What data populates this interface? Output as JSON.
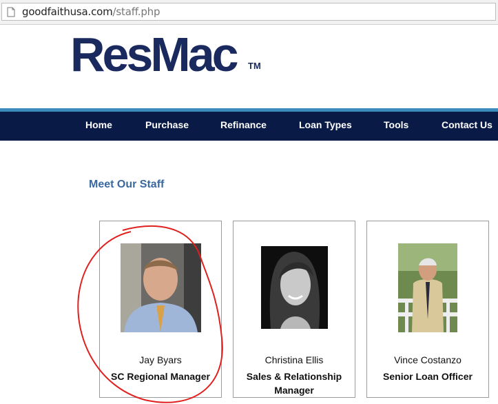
{
  "browser": {
    "url_host": "goodfaithusa.com",
    "url_path": "/staff.php"
  },
  "logo": {
    "text": "ResMac",
    "tm": "TM"
  },
  "nav": {
    "items": [
      {
        "label": "Home"
      },
      {
        "label": "Purchase"
      },
      {
        "label": "Refinance"
      },
      {
        "label": "Loan Types"
      },
      {
        "label": "Tools"
      },
      {
        "label": "Contact Us"
      }
    ]
  },
  "main": {
    "heading": "Meet Our Staff",
    "staff": [
      {
        "name": "Jay Byars",
        "role": "SC Regional Manager"
      },
      {
        "name": "Christina Ellis",
        "role": "Sales & Relationship Manager"
      },
      {
        "name": "Vince Costanzo",
        "role": "Senior Loan Officer"
      }
    ]
  },
  "colors": {
    "nav_bg": "#0a1a47",
    "nav_accent": "#3c8bbd",
    "logo": "#1a2a5e",
    "heading": "#3a68a0",
    "annotation": "#e0201e"
  }
}
